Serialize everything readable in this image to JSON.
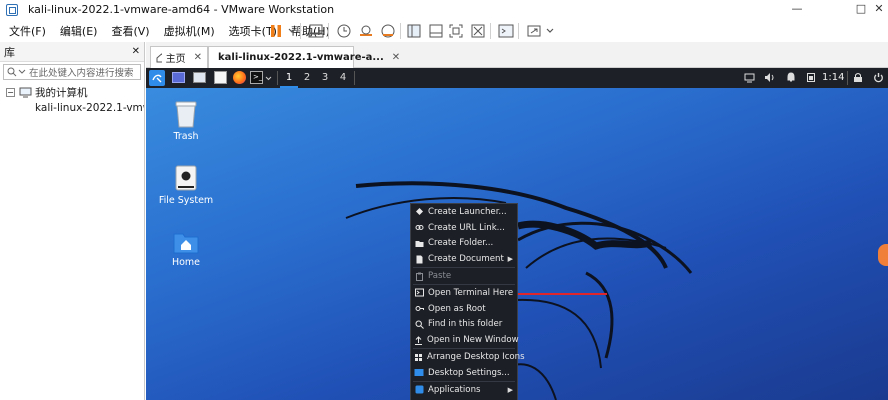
{
  "window": {
    "title": "kali-linux-2022.1-vmware-amd64 - VMware Workstation",
    "controls": [
      "—",
      "□",
      "✕"
    ]
  },
  "menu": [
    "文件(F)",
    "编辑(E)",
    "查看(V)",
    "虚拟机(M)",
    "选项卡(T)",
    "帮助(H)"
  ],
  "library": {
    "title": "库",
    "close": "✕",
    "search_placeholder": "在此处键入内容进行搜索",
    "tree": {
      "root": "我的计算机",
      "child": "kali-linux-2022.1-vmw"
    }
  },
  "tabs": [
    {
      "label": "主页",
      "close": "✕"
    },
    {
      "label": "kali-linux-2022.1-vmware-a...",
      "close": "✕"
    }
  ],
  "vm": {
    "panel": {
      "workspaces": [
        "1",
        "2",
        "3",
        "4"
      ],
      "active_workspace": "1",
      "time": "1:14"
    },
    "desktop_icons": [
      {
        "label": "Trash",
        "icon": "trash-icon"
      },
      {
        "label": "File System",
        "icon": "drive-icon"
      },
      {
        "label": "Home",
        "icon": "home-folder-icon"
      }
    ],
    "context_menu": {
      "items": [
        {
          "label": "Create Launcher...",
          "icon": "launcher-icon"
        },
        {
          "label": "Create URL Link...",
          "icon": "link-icon"
        },
        {
          "label": "Create Folder...",
          "icon": "folder-icon"
        },
        {
          "label": "Create Document",
          "icon": "document-icon",
          "submenu": true
        },
        {
          "label": "Paste",
          "icon": "paste-icon",
          "disabled": true
        },
        {
          "label": "Open Terminal Here",
          "icon": "terminal-icon"
        },
        {
          "label": "Open as Root",
          "icon": "root-icon"
        },
        {
          "label": "Find in this folder",
          "icon": "search-icon"
        },
        {
          "label": "Open in New Window",
          "icon": "new-window-icon"
        },
        {
          "label": "Arrange Desktop Icons",
          "icon": "arrange-icon"
        },
        {
          "label": "Desktop Settings...",
          "icon": "settings-icon"
        },
        {
          "label": "Applications",
          "icon": "applications-icon",
          "submenu": true
        }
      ]
    }
  },
  "colors": {
    "accent": "#2f8ce8",
    "annotation_arrow": "#e0262b",
    "panel_bg": "#1d2026",
    "menu_bg": "#1c1f26"
  }
}
